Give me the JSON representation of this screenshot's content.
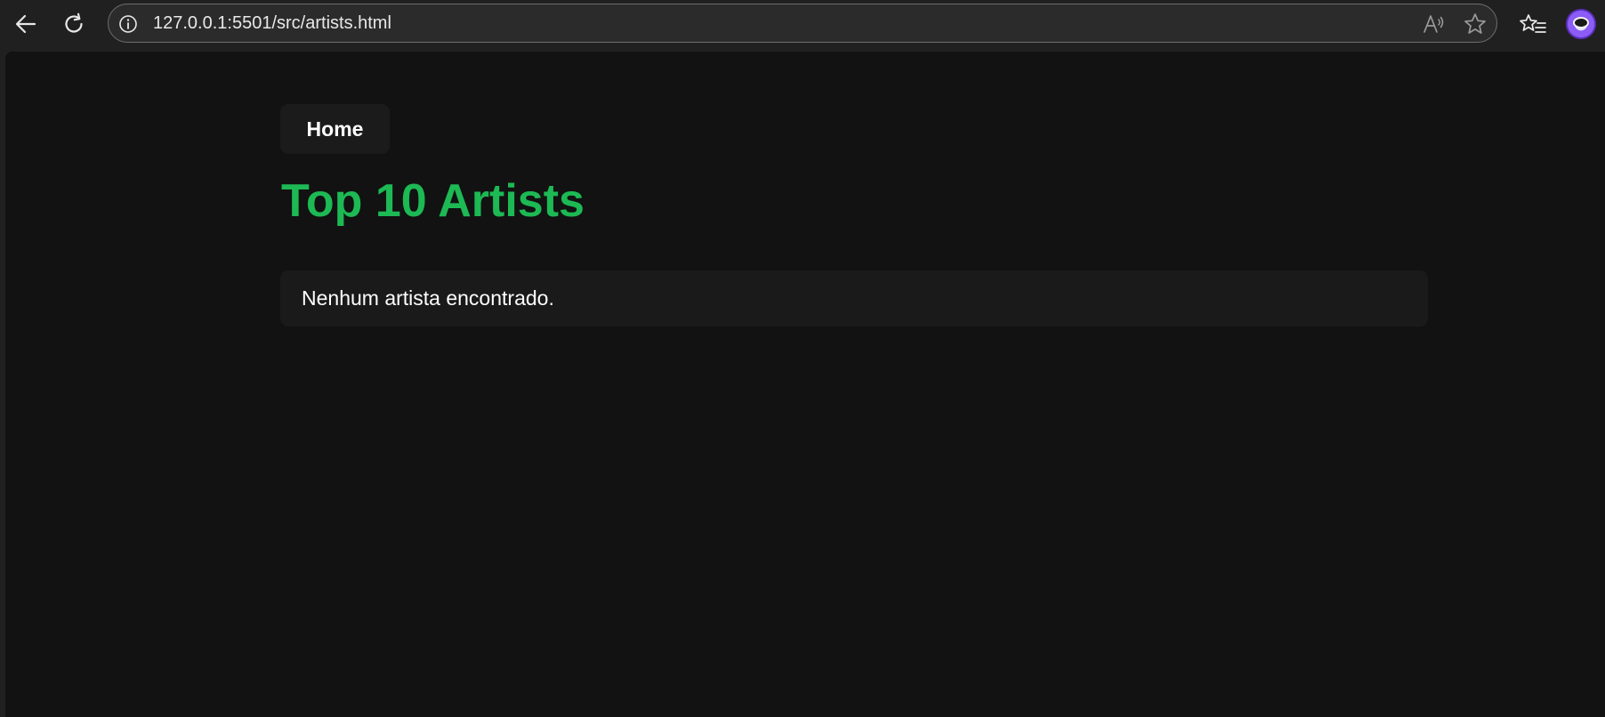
{
  "browser": {
    "url": "127.0.0.1:5501/src/artists.html"
  },
  "nav": {
    "home_label": "Home"
  },
  "page": {
    "title": "Top 10 Artists",
    "empty_message": "Nenhum artista encontrado."
  },
  "colors": {
    "accent": "#1db954",
    "background": "#121212",
    "card": "#1a1a1a",
    "toolbar": "#202020"
  }
}
